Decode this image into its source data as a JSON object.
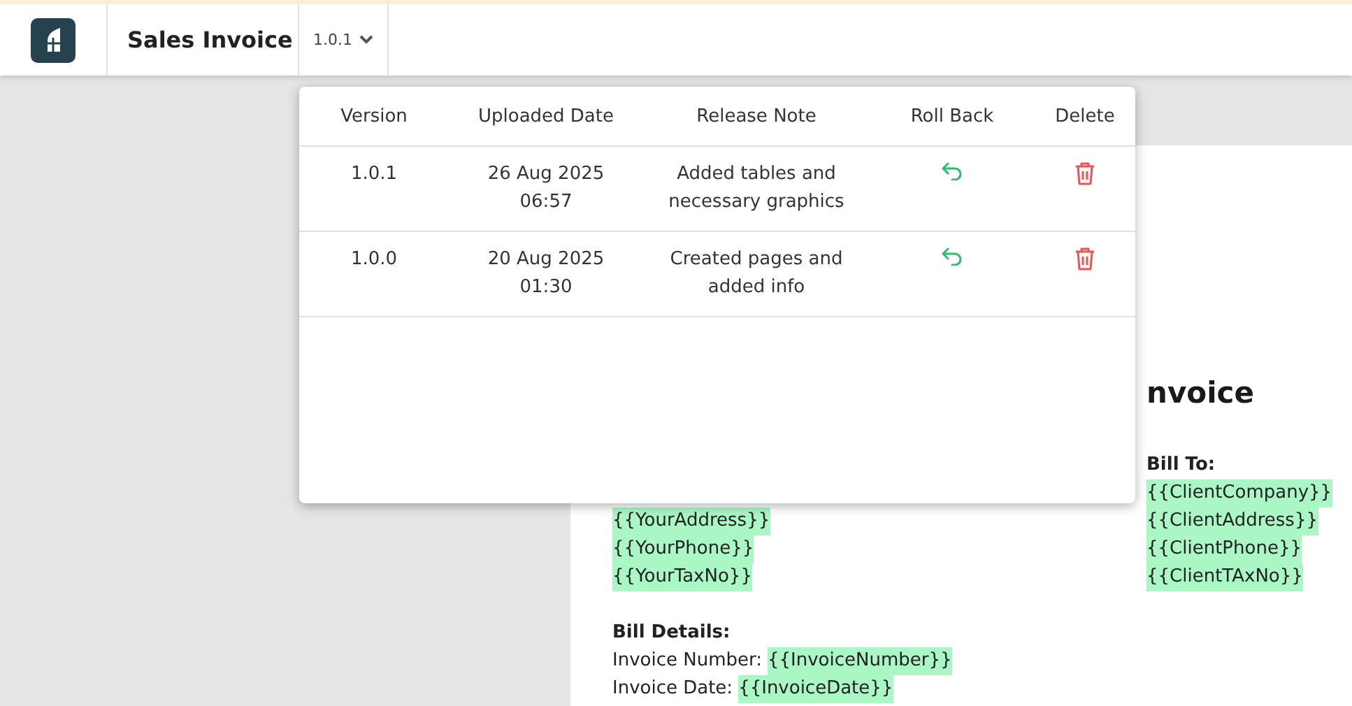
{
  "top_bar": {
    "title": "Sales Invoice",
    "version_selector": {
      "label": "1.0.1"
    }
  },
  "version_popup": {
    "columns": [
      "Version",
      "Uploaded Date",
      "Release Note",
      "Roll Back",
      "Delete"
    ],
    "rows": [
      {
        "version": "1.0.1",
        "uploaded": "26 Aug 2025 06:57",
        "release_note": "Added tables and necessary graphics"
      },
      {
        "version": "1.0.0",
        "uploaded": "20 Aug 2025 01:30",
        "release_note": "Created pages and added info"
      }
    ]
  },
  "document": {
    "heading": "nvoice",
    "sender_lines": [
      "{{YourAddress}}",
      "{{YourPhone}}",
      "{{YourTaxNo}}"
    ],
    "bill_to": {
      "label": "Bill To:",
      "lines": [
        "{{ClientCompany}}",
        "{{ClientAddress}}",
        "{{ClientPhone}}",
        "{{ClientTAxNo}}"
      ]
    },
    "bill_details": {
      "label": "Bill Details:",
      "fields": [
        {
          "label": "Invoice Number:",
          "value": "{{InvoiceNumber}}"
        },
        {
          "label": "Invoice Date:",
          "value": "{{InvoiceDate}}"
        }
      ]
    }
  }
}
